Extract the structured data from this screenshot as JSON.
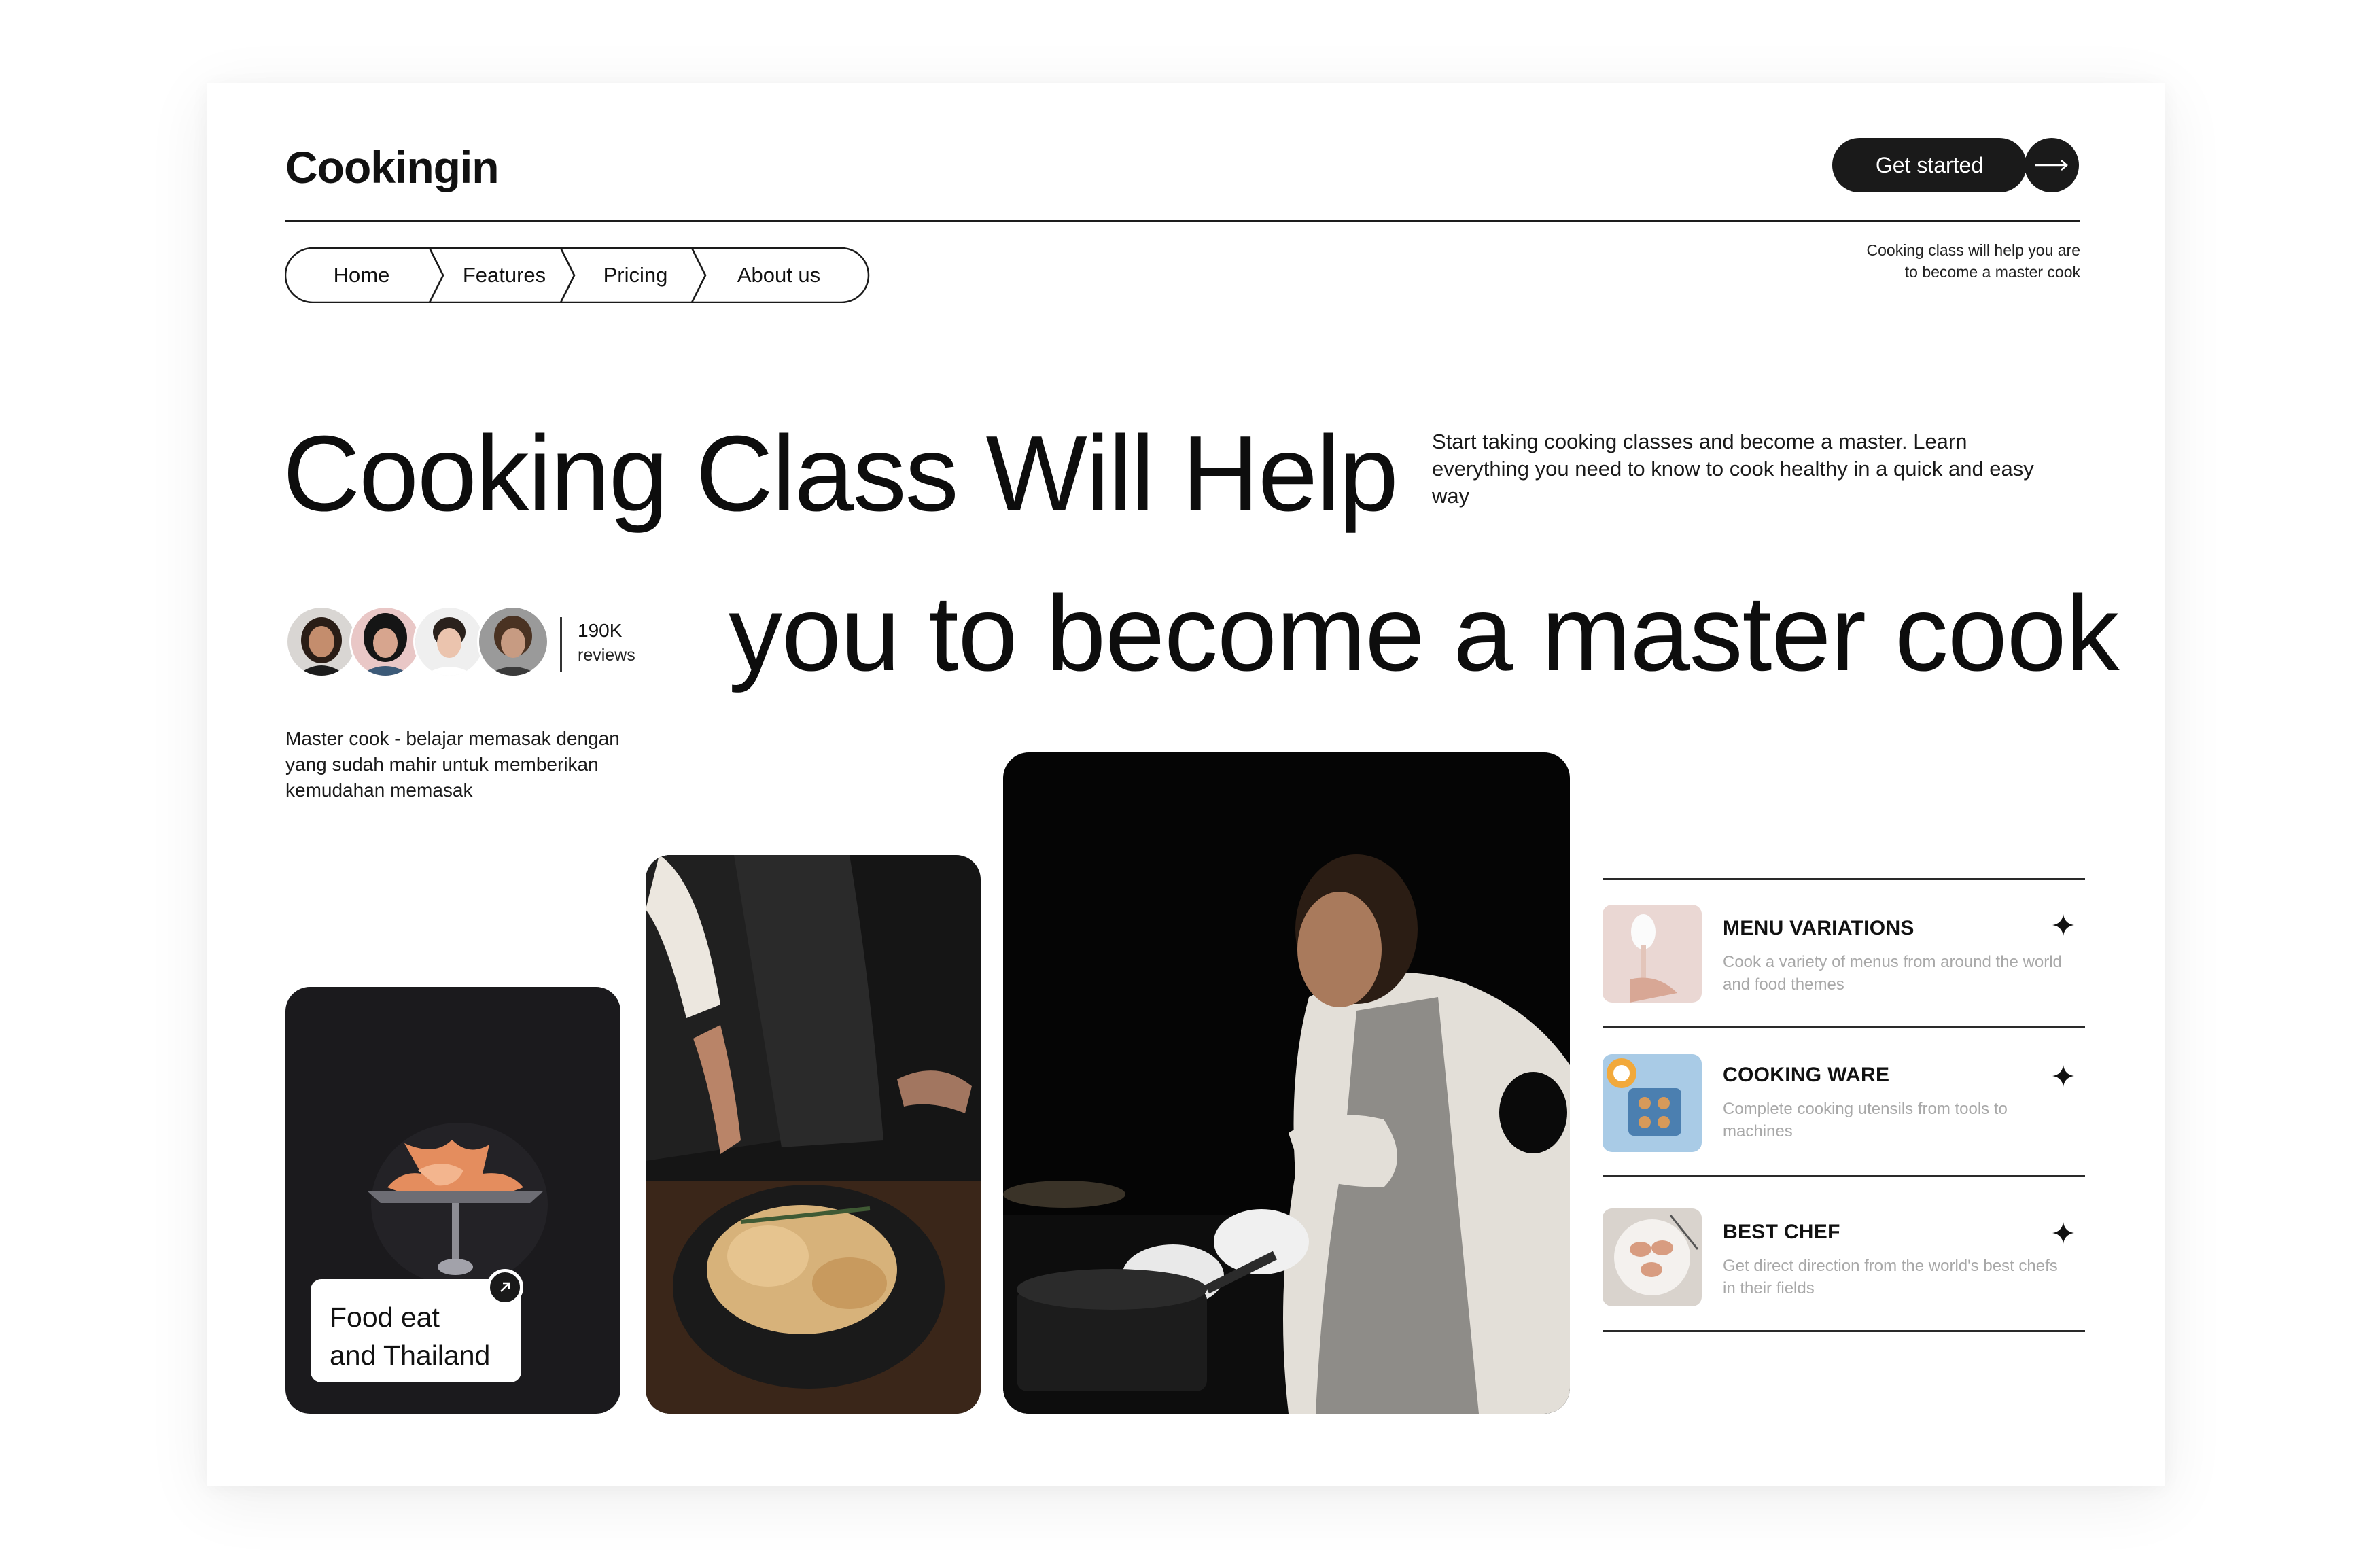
{
  "brand": {
    "logo": "Cookingin"
  },
  "cta": {
    "label": "Get started",
    "icon": "arrow-right-icon"
  },
  "nav": {
    "items": [
      "Home",
      "Features",
      "Pricing",
      "About us"
    ]
  },
  "tagline": "Cooking class will help you are to become a master cook",
  "hero": {
    "line1": "Cooking Class Will Help",
    "line2": "you to become a master cook",
    "description": "Start taking cooking classes and become a master. Learn everything you need to know to cook healthy in a quick and easy way"
  },
  "reviews": {
    "count": "190K",
    "label": "reviews"
  },
  "master_desc": "Master cook - belajar memasak dengan yang sudah mahir untuk memberikan kemudahan memasak",
  "photo_card": {
    "line1": "Food eat",
    "line2": "and Thailand",
    "badge_icon": "arrow-up-right-icon"
  },
  "features": [
    {
      "title": "MENU VARIATIONS",
      "description": "Cook a variety of menus from around the world and food themes",
      "icon": "sparkle-icon"
    },
    {
      "title": "COOKING WARE",
      "description": "Complete cooking utensils from tools to machines",
      "icon": "sparkle-icon"
    },
    {
      "title": "BEST CHEF",
      "description": "Get direct direction from the world's best chefs in their fields",
      "icon": "sparkle-icon"
    }
  ],
  "colors": {
    "dark": "#1a1a1a",
    "muted": "#a8a8a8",
    "background": "#ffffff"
  }
}
